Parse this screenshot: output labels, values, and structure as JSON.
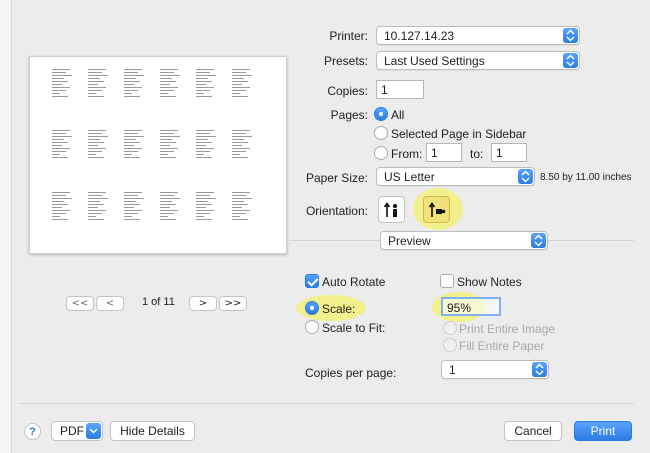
{
  "printer": {
    "label": "Printer:",
    "value": "10.127.14.23"
  },
  "presets": {
    "label": "Presets:",
    "value": "Last Used Settings"
  },
  "copies": {
    "label": "Copies:",
    "value": "1"
  },
  "pages": {
    "label": "Pages:",
    "all": "All",
    "selected": "Selected Page in Sidebar",
    "from_label": "From:",
    "from_value": "1",
    "to_label": "to:",
    "to_value": "1"
  },
  "paper_size": {
    "label": "Paper Size:",
    "value": "US Letter",
    "dimensions": "8.50 by 11.00 inches"
  },
  "orientation": {
    "label": "Orientation:",
    "selected": "landscape"
  },
  "section_popup": {
    "value": "Preview"
  },
  "preview_options": {
    "auto_rotate": "Auto Rotate",
    "auto_rotate_checked": true,
    "show_notes": "Show Notes",
    "show_notes_checked": false,
    "scale_label": "Scale:",
    "scale_value": "95%",
    "scale_to_fit": "Scale to Fit:",
    "print_entire_image": "Print Entire Image",
    "fill_entire_paper": "Fill Entire Paper",
    "copies_per_page_label": "Copies per page:",
    "copies_per_page_value": "1"
  },
  "pager": {
    "first": "<<",
    "prev": "<",
    "page_text": "1 of 11",
    "next": ">",
    "last": ">>"
  },
  "footer": {
    "help": "?",
    "pdf": "PDF",
    "hide_details": "Hide Details",
    "cancel": "Cancel",
    "print": "Print"
  },
  "colors": {
    "accent": "#2a7de1",
    "highlight": "#f6f440"
  },
  "icons": {
    "stepper": "up-down-arrows-icon",
    "pdf_menu": "chevron-down-icon",
    "portrait": "portrait-orientation-icon",
    "landscape": "landscape-orientation-icon"
  }
}
